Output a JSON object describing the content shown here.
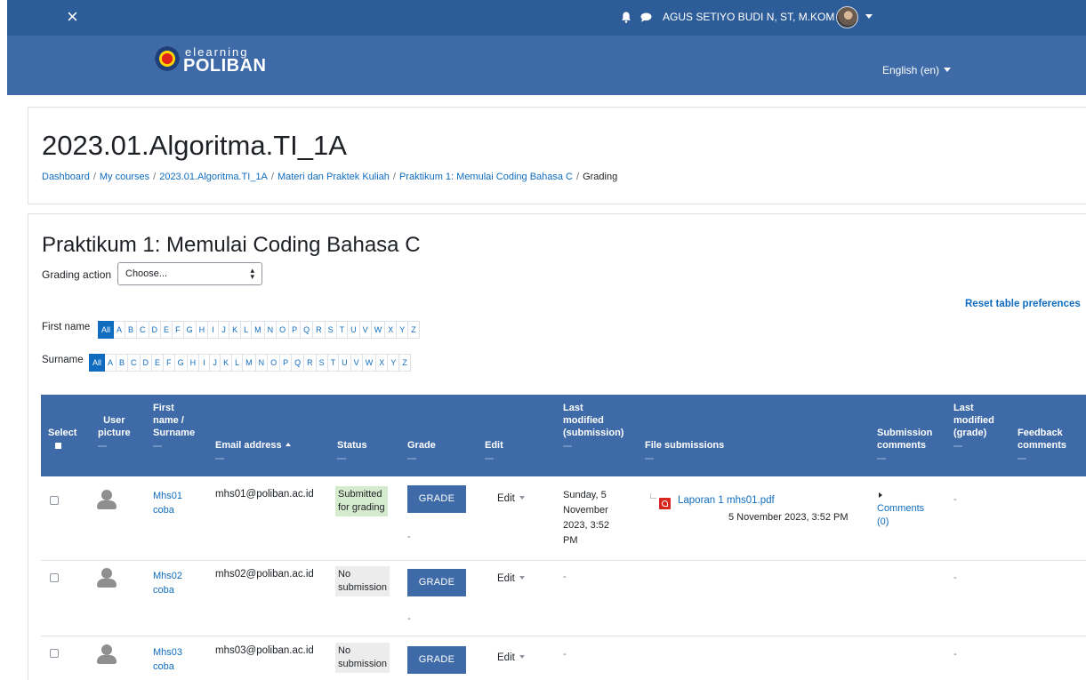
{
  "navbar": {
    "close_glyph": "×",
    "user_name": "AGUS SETIYO BUDI N, ST, M.KOM",
    "icons": [
      "bell-icon",
      "chat-icon",
      "user-avatar",
      "chevron-down-icon"
    ]
  },
  "brand": {
    "logo_small": "elearning",
    "logo_big": "POLIBAN",
    "language": "English (en)"
  },
  "header": {
    "course_title": "2023.01.Algoritma.TI_1A",
    "breadcrumb": {
      "dashboard": "Dashboard",
      "my_courses": "My courses",
      "course": "2023.01.Algoritma.TI_1A",
      "section": "Materi dan Praktek Kuliah",
      "activity": "Praktikum 1: Memulai Coding Bahasa C",
      "current": "Grading",
      "separator": "/"
    }
  },
  "main": {
    "activity_title": "Praktikum 1: Memulai Coding Bahasa C",
    "grading_action_label": "Grading action",
    "grading_action_value": "Choose...",
    "reset_link": "Reset table preferences",
    "first_name_label": "First name",
    "surname_label": "Surname",
    "letters": [
      "All",
      "A",
      "B",
      "C",
      "D",
      "E",
      "F",
      "G",
      "H",
      "I",
      "J",
      "K",
      "L",
      "M",
      "N",
      "O",
      "P",
      "Q",
      "R",
      "S",
      "T",
      "U",
      "V",
      "W",
      "X",
      "Y",
      "Z"
    ]
  },
  "table": {
    "headers": {
      "select": "Select",
      "user_picture_1": "User",
      "user_picture_2": "picture",
      "first_name_1": "First",
      "first_name_2": "name /",
      "first_name_3": "Surname",
      "email": "Email address",
      "status": "Status",
      "grade": "Grade",
      "edit": "Edit",
      "last_mod_sub_1": "Last",
      "last_mod_sub_2": "modified",
      "last_mod_sub_3": "(submission)",
      "file_submissions": "File submissions",
      "sub_comments_1": "Submission",
      "sub_comments_2": "comments",
      "last_mod_grade_1": "Last",
      "last_mod_grade_2": "modified",
      "last_mod_grade_3": "(grade)",
      "feedback_1": "Feedback",
      "feedback_2": "comments"
    },
    "rows": [
      {
        "first": "Mhs01",
        "last": "coba",
        "email": "mhs01@poliban.ac.id",
        "status_1": "Submitted",
        "status_2": "for grading",
        "grade_button": "GRADE",
        "grade_value": "-",
        "edit": "Edit",
        "modified_1": "Sunday, 5",
        "modified_2": "November",
        "modified_3": "2023, 3:52",
        "modified_4": "PM",
        "file_name": "Laporan 1 mhs01.pdf",
        "file_date": "5 November 2023, 3:52 PM",
        "comments_1": "Comments",
        "comments_2": "(0)",
        "grade_modified": "-"
      },
      {
        "first": "Mhs02",
        "last": "coba",
        "email": "mhs02@poliban.ac.id",
        "status_1": "No",
        "status_2": "submission",
        "grade_button": "GRADE",
        "grade_value": "-",
        "edit": "Edit",
        "modified": "-",
        "grade_modified": "-"
      },
      {
        "first": "Mhs03",
        "last": "coba",
        "email": "mhs03@poliban.ac.id",
        "status_1": "No",
        "status_2": "submission",
        "grade_button": "GRADE",
        "edit": "Edit",
        "modified": "-",
        "grade_modified": "-"
      }
    ]
  },
  "colors": {
    "navbar": "#2d5d98",
    "banner": "#3e6aa8",
    "link": "#0f6cbf",
    "submitted_bg": "#d5ebce",
    "no_submission_bg": "#ececec"
  }
}
